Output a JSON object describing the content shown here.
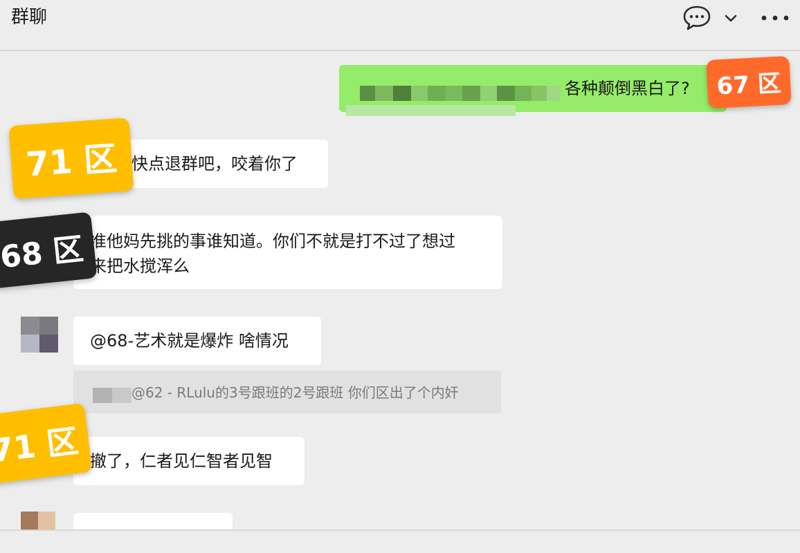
{
  "header": {
    "title": "群聊",
    "icons": [
      "chat-bubble-icon",
      "chevron-down-icon",
      "more-icon"
    ]
  },
  "messages": [
    {
      "side": "right",
      "text": "各种颠倒黑白了?"
    },
    {
      "side": "left",
      "text": "快点退群吧，咬着你了"
    },
    {
      "side": "left",
      "lines": [
        "准他妈先挑的事谁知道。你们不就是打不过了想过",
        "来把水搅浑么"
      ]
    },
    {
      "side": "left",
      "text": "@68-艺术就是爆炸 啥情况",
      "quote": "@62 - RLulu的3号跟班的2号跟班 你们区出了个内奸"
    },
    {
      "side": "left",
      "text": "撤了，仁者见仁智者见智"
    }
  ],
  "stickers": {
    "s67": "67 区",
    "s71a": "71 区",
    "s68": "68 区",
    "s71b": "71 区"
  },
  "colors": {
    "background": "#ededed",
    "bubble_self": "#95ec69",
    "bubble_other": "#ffffff",
    "sticker_orange": "#ff6a2b",
    "sticker_yellow": "#ffbf00",
    "sticker_dark": "#262626"
  }
}
